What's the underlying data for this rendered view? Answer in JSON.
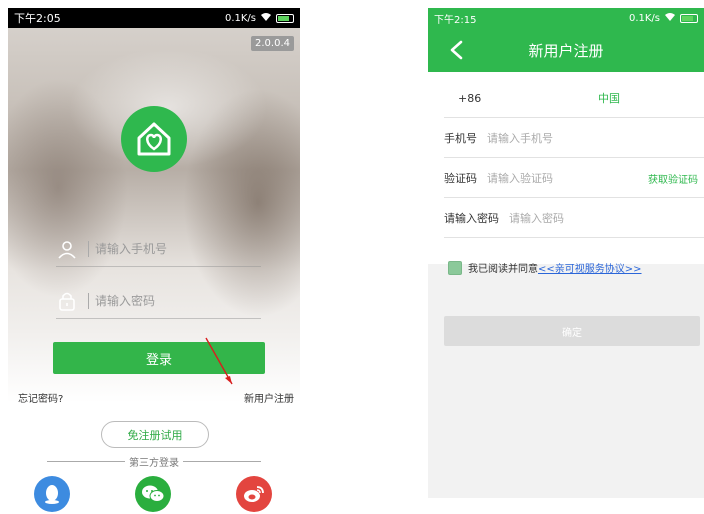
{
  "login_screen": {
    "status_bar": {
      "time": "下午2:05",
      "speed": "0.1K/s"
    },
    "version": "2.0.0.4",
    "phone_placeholder": "请输入手机号",
    "password_placeholder": "请输入密码",
    "login_label": "登录",
    "forgot_label": "忘记密码?",
    "register_label": "新用户注册",
    "trial_label": "免注册试用",
    "third_party_label": "第三方登录",
    "social": [
      "qq-icon",
      "wechat-icon",
      "weibo-icon"
    ]
  },
  "register_screen": {
    "status_bar": {
      "time": "下午2:15",
      "speed": "0.1K/s"
    },
    "title": "新用户注册",
    "country_code": "+86",
    "country_name": "中国",
    "phone_label": "手机号",
    "phone_placeholder": "请输入手机号",
    "code_label": "验证码",
    "code_placeholder": "请输入验证码",
    "get_code_label": "获取验证码",
    "password_label": "请输入密码",
    "password_placeholder": "请输入密码",
    "agree_prefix": "我已阅读并同意",
    "agree_link": "<<亲可视服务协议>>",
    "confirm_label": "确定"
  },
  "colors": {
    "brand_green": "#2fb84e",
    "link_blue": "#2b66d9",
    "disabled_gray": "#dcdcdc"
  }
}
